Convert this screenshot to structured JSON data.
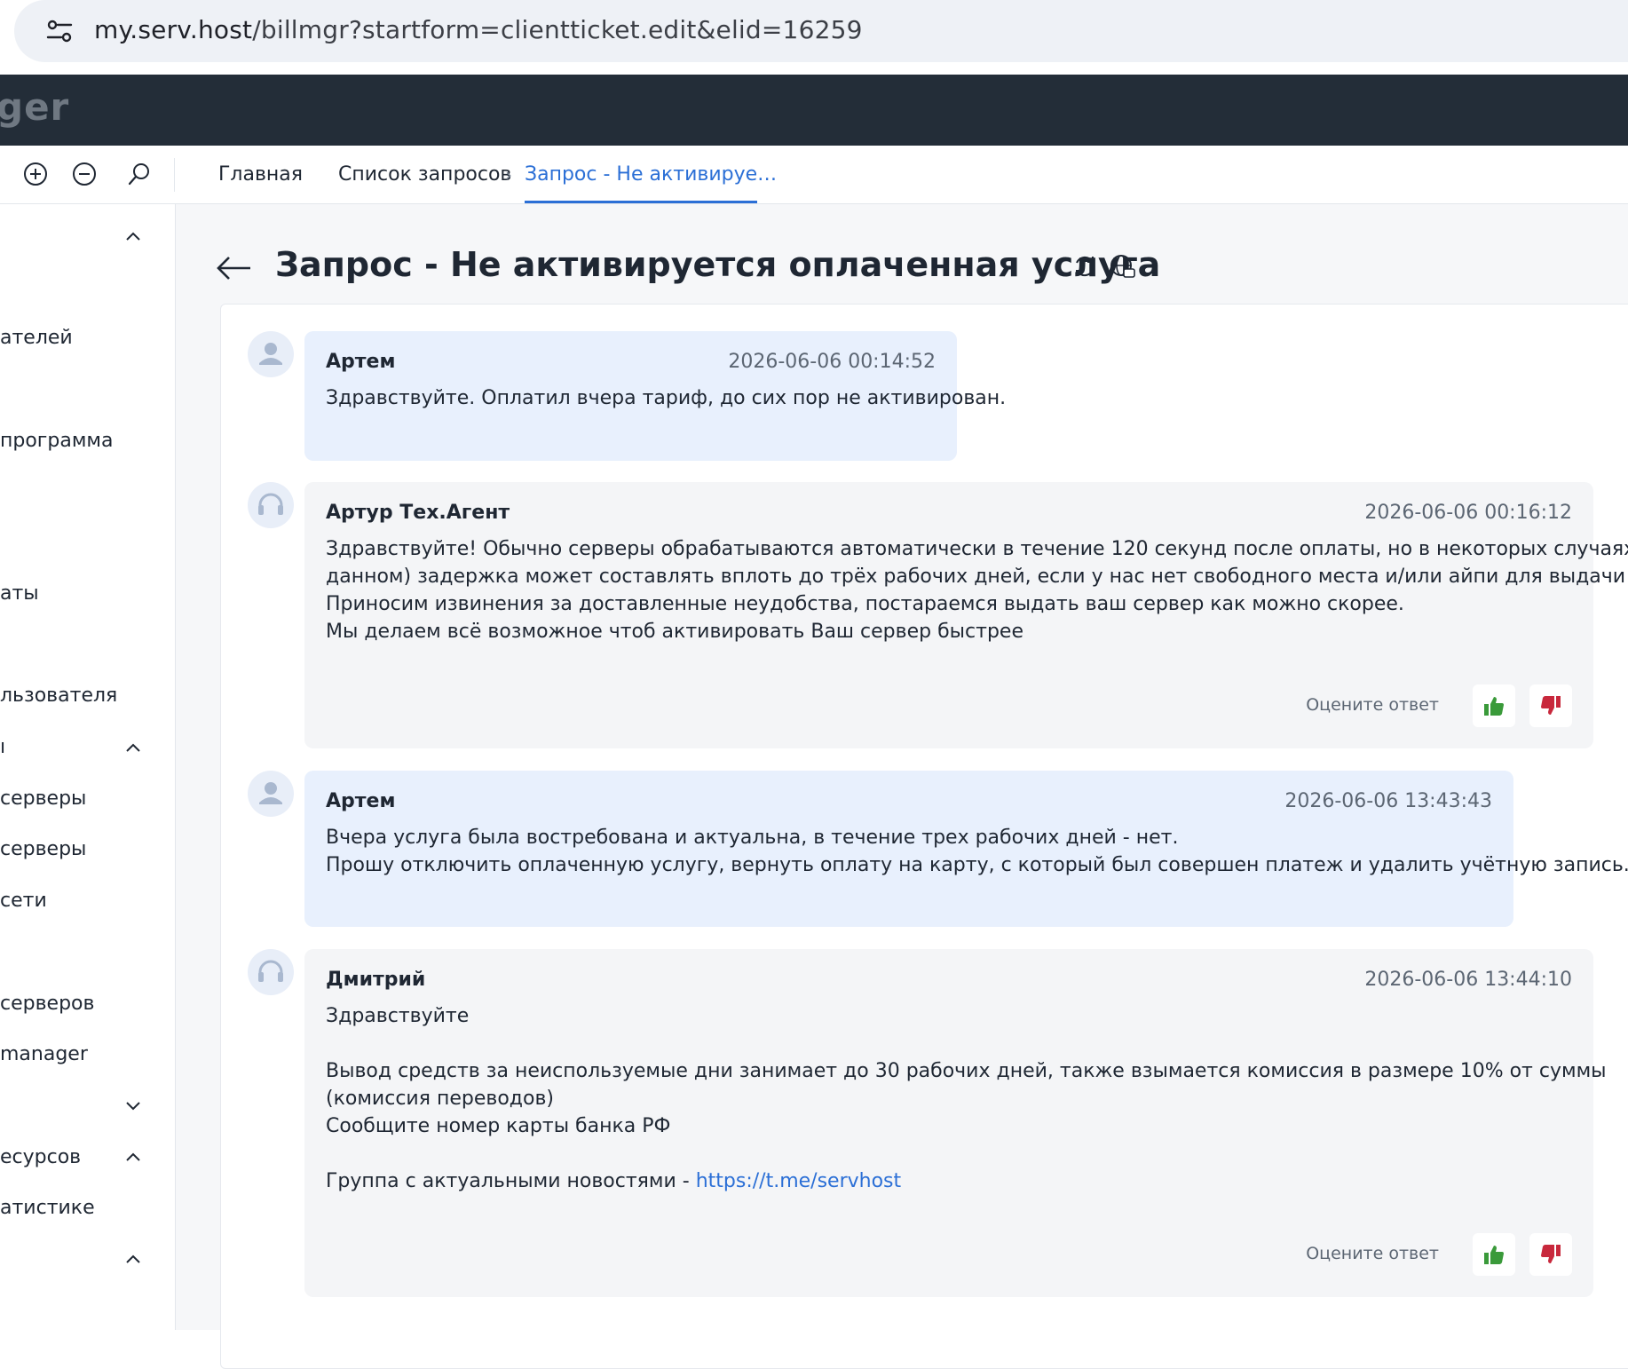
{
  "browser": {
    "url_host": "my.serv.host",
    "url_path": "/billmgr?startform=clientticket.edit&elid=16259"
  },
  "app": {
    "brand_fragment": "ger"
  },
  "breadcrumb": {
    "items": [
      "Главная",
      "Список запросов",
      "Запрос - Не активируе…"
    ]
  },
  "sidebar": {
    "items": [
      {
        "label": "ателей",
        "chevron": ""
      },
      {
        "label": " программа",
        "chevron": ""
      },
      {
        "label": "аты",
        "chevron": ""
      },
      {
        "label": "льзователя",
        "chevron": ""
      },
      {
        "label": "ı",
        "chevron": "up"
      },
      {
        "label": "серверы",
        "chevron": ""
      },
      {
        "label": "серверы",
        "chevron": ""
      },
      {
        "label": "сети",
        "chevron": ""
      },
      {
        "label": "серверов",
        "chevron": ""
      },
      {
        "label": "manager",
        "chevron": ""
      },
      {
        "label": "есурсов",
        "chevron": "up"
      },
      {
        "label": "атистике",
        "chevron": ""
      }
    ]
  },
  "page": {
    "title": "Запрос - Не активируется оплаченная услуга"
  },
  "messages": [
    {
      "author": "Артем",
      "timestamp": "2026-06-06 00:14:52",
      "lines": [
        "Здравствуйте. Оплатил вчера тариф, до сих пор не активирован."
      ]
    },
    {
      "author": "Артур Тех.Агент",
      "timestamp": "2026-06-06 00:16:12",
      "lines": [
        "Здравствуйте! Обычно серверы обрабатываются автоматически в течение 120 секунд после оплаты, но в некоторых случаях (как в",
        "данном) задержка может составлять вплоть до трёх рабочих дней, если у нас нет свободного места и/или айпи для выдачи услуги.",
        "Приносим извинения за доставленные неудобства, постараемся выдать ваш сервер как можно скорее.",
        "Мы делаем всё возможное чтоб активировать Ваш сервер быстрее"
      ],
      "rate_label": "Оцените ответ"
    },
    {
      "author": "Артем",
      "timestamp": "2026-06-06 13:43:43",
      "lines": [
        "Вчера услуга была востребована и актуальна, в течение трех рабочих дней - нет.",
        "Прошу отключить оплаченную услугу, вернуть оплату на карту, с который был совершен платеж и удалить учётную запись."
      ]
    },
    {
      "author": "Дмитрий",
      "timestamp": "2026-06-06 13:44:10",
      "lines": [
        "Здравствуйте",
        "",
        "Вывод средств за неиспользуемые дни занимает до 30 рабочих дней, также взымается комиссия в размере 10% от суммы",
        "(комиссия переводов)",
        "Сообщите номер карты банка РФ",
        ""
      ],
      "link_prefix": "Группа с актуальными новостями - ",
      "link_text": "https://t.me/servhost",
      "rate_label": "Оцените ответ"
    }
  ],
  "colors": {
    "accent": "#2b6fd6",
    "header_bg": "#232d38",
    "client_bubble": "#e8f0fd",
    "agent_bubble": "#f4f5f7",
    "thumb_up": "#3a9a3a",
    "thumb_down": "#c8283c"
  },
  "icons": {
    "address": "site-settings-icon",
    "zoom_in": "zoom-in-icon",
    "zoom_out": "zoom-out-icon",
    "search": "search-icon",
    "back": "back-arrow-icon",
    "refresh": "refresh-icon",
    "globe": "globe-icon",
    "client_avatar": "user-avatar-icon",
    "agent_avatar": "headset-icon",
    "like": "thumbs-up-icon",
    "dislike": "thumbs-down-icon"
  }
}
